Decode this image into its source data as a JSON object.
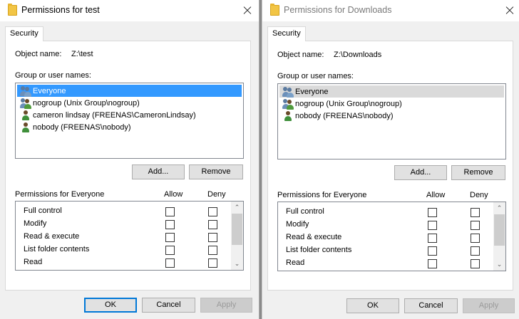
{
  "left": {
    "title": "Permissions for test",
    "tab": "Security",
    "object_name_label": "Object name:",
    "object_name_value": "Z:\\test",
    "group_label": "Group or user names:",
    "users": [
      "Everyone",
      "nogroup (Unix Group\\nogroup)",
      "cameron lindsay (FREENAS\\CameronLindsay)",
      "nobody (FREENAS\\nobody)"
    ],
    "add_label": "Add...",
    "remove_label": "Remove",
    "perm_label": "Permissions for Everyone",
    "allow_label": "Allow",
    "deny_label": "Deny",
    "permissions": [
      "Full control",
      "Modify",
      "Read & execute",
      "List folder contents",
      "Read"
    ],
    "ok_label": "OK",
    "cancel_label": "Cancel",
    "apply_label": "Apply"
  },
  "right": {
    "title": "Permissions for Downloads",
    "tab": "Security",
    "object_name_label": "Object name:",
    "object_name_value": "Z:\\Downloads",
    "group_label": "Group or user names:",
    "users": [
      "Everyone",
      "nogroup (Unix Group\\nogroup)",
      "nobody (FREENAS\\nobody)"
    ],
    "add_label": "Add...",
    "remove_label": "Remove",
    "perm_label": "Permissions for Everyone",
    "allow_label": "Allow",
    "deny_label": "Deny",
    "permissions": [
      "Full control",
      "Modify",
      "Read & execute",
      "List folder contents",
      "Read"
    ],
    "ok_label": "OK",
    "cancel_label": "Cancel",
    "apply_label": "Apply"
  },
  "icons": {
    "folder": "folder-icon",
    "group": "user-group-icon",
    "user": "user-icon",
    "close": "close-icon",
    "scroll_up": "scroll-up-arrow-icon",
    "scroll_down": "scroll-down-arrow-icon"
  },
  "colors": {
    "selection": "#3399ff",
    "selection_inactive": "#dadada",
    "default_button_border": "#0078d7"
  },
  "glyphs": {
    "scroll_up": "⌃",
    "scroll_down": "⌄"
  }
}
